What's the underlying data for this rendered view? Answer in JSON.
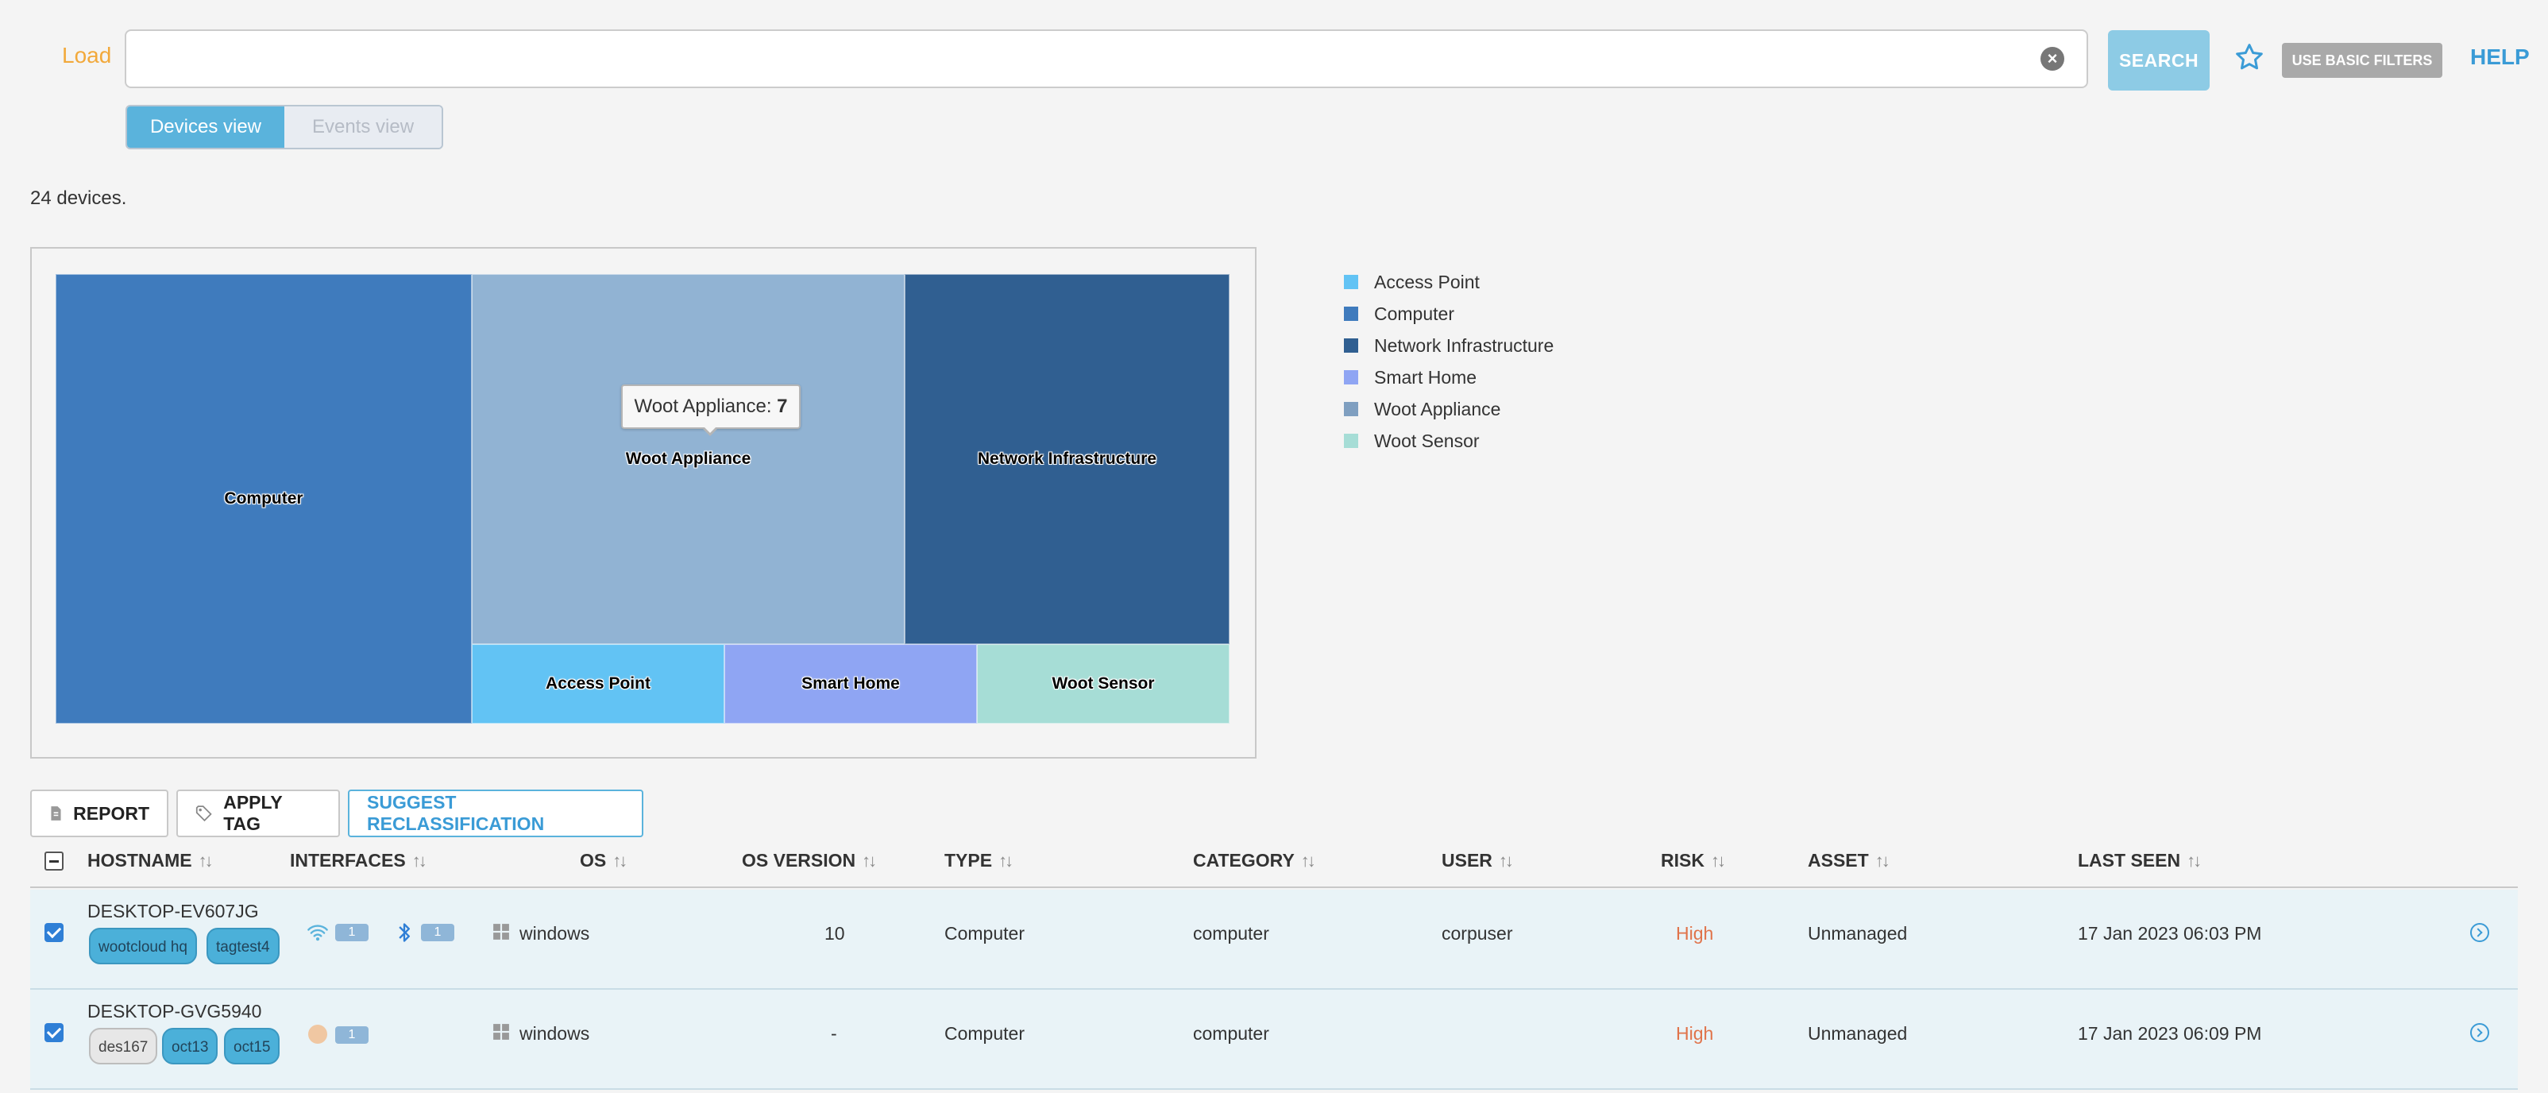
{
  "topbar": {
    "load_label": "Load",
    "search_value": "",
    "search_button": "SEARCH",
    "basic_filters_button": "USE BASIC FILTERS",
    "help_link": "HELP",
    "views": [
      "Devices view",
      "Events view"
    ]
  },
  "summary": {
    "count_text": "24 devices."
  },
  "chart_data": {
    "type": "treemap",
    "title": "",
    "cells": [
      {
        "name": "Computer",
        "value": 8,
        "color": "#3f7bbd"
      },
      {
        "name": "Woot Appliance",
        "value": 7,
        "color": "#91b3d3"
      },
      {
        "name": "Network Infrastructure",
        "value": 5,
        "color": "#305f91"
      },
      {
        "name": "Access Point",
        "value": 1,
        "color": "#62c3f4"
      },
      {
        "name": "Smart Home",
        "value": 1,
        "color": "#8fa5f3"
      },
      {
        "name": "Woot Sensor",
        "value": 1,
        "color": "#a6ddd6"
      }
    ],
    "legend": [
      "Access Point",
      "Computer",
      "Network Infrastructure",
      "Smart Home",
      "Woot Appliance",
      "Woot Sensor"
    ],
    "legend_colors": [
      "#62c3f4",
      "#3f7bbd",
      "#305f91",
      "#8fa5f3",
      "#7f9fc0",
      "#a6ddd6"
    ],
    "legend_placement": "right",
    "tooltip": {
      "label": "Woot Appliance: ",
      "value": "7"
    }
  },
  "actions": {
    "report": "REPORT",
    "apply_tag": "APPLY TAG",
    "suggest": "SUGGEST RECLASSIFICATION"
  },
  "table": {
    "headers": [
      "HOSTNAME",
      "INTERFACES",
      "OS",
      "OS VERSION",
      "TYPE",
      "CATEGORY",
      "USER",
      "RISK",
      "ASSET",
      "LAST SEEN"
    ],
    "sort_glyph": "↑↓",
    "rows": [
      {
        "hostname": "DESKTOP-EV607JG",
        "tags": [
          "wootcloud hq",
          "tagtest4"
        ],
        "iface_counts": [
          "1",
          "1"
        ],
        "os": "windows",
        "os_version": "10",
        "type": "Computer",
        "category": "computer",
        "user": "corpuser",
        "risk": "High",
        "asset": "Unmanaged",
        "last_seen": "17 Jan 2023 06:03 PM"
      },
      {
        "hostname": "DESKTOP-GVG5940",
        "tags": [
          "des167",
          "oct13",
          "oct15"
        ],
        "iface_counts": [
          "1"
        ],
        "os": "windows",
        "os_version": "-",
        "type": "Computer",
        "category": "computer",
        "user": "",
        "risk": "High",
        "asset": "Unmanaged",
        "last_seen": "17 Jan 2023 06:09 PM"
      }
    ]
  }
}
